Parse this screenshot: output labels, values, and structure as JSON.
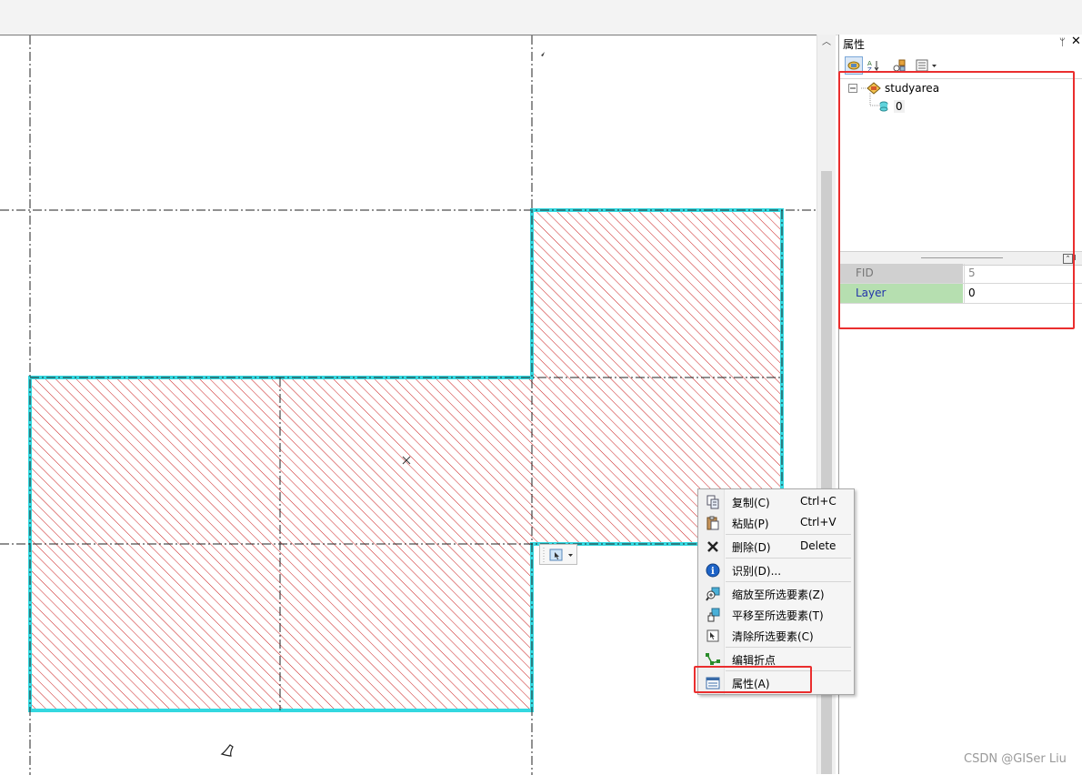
{
  "panel": {
    "title": "属性",
    "pin_glyph": "ᛘ",
    "close_glyph": "✕",
    "tree_root": "studyarea",
    "tree_child": "0",
    "attributes": [
      {
        "key": "FID",
        "value": "5"
      },
      {
        "key": "Layer",
        "value": "0"
      }
    ]
  },
  "context_menu": {
    "items": [
      {
        "label": "复制(C)",
        "shortcut": "Ctrl+C",
        "icon": "copy-icon"
      },
      {
        "label": "粘贴(P)",
        "shortcut": "Ctrl+V",
        "icon": "paste-icon"
      },
      {
        "label": "删除(D)",
        "shortcut": "Delete",
        "icon": "delete-icon"
      },
      {
        "label": "识别(D)...",
        "shortcut": "",
        "icon": "info-icon"
      },
      {
        "label": "缩放至所选要素(Z)",
        "shortcut": "",
        "icon": "zoom-to-selected-icon"
      },
      {
        "label": "平移至所选要素(T)",
        "shortcut": "",
        "icon": "pan-to-selected-icon"
      },
      {
        "label": "清除所选要素(C)",
        "shortcut": "",
        "icon": "clear-selection-icon"
      },
      {
        "label": "编辑折点",
        "shortcut": "",
        "icon": "edit-vertices-icon"
      },
      {
        "label": "属性(A)",
        "shortcut": "",
        "icon": "attributes-icon"
      }
    ]
  },
  "watermark": "CSDN @GISer Liu",
  "colors": {
    "selection_outline": "#34d8e0",
    "hatch": "#cc2020",
    "annotation_box": "#ea2e2e"
  }
}
